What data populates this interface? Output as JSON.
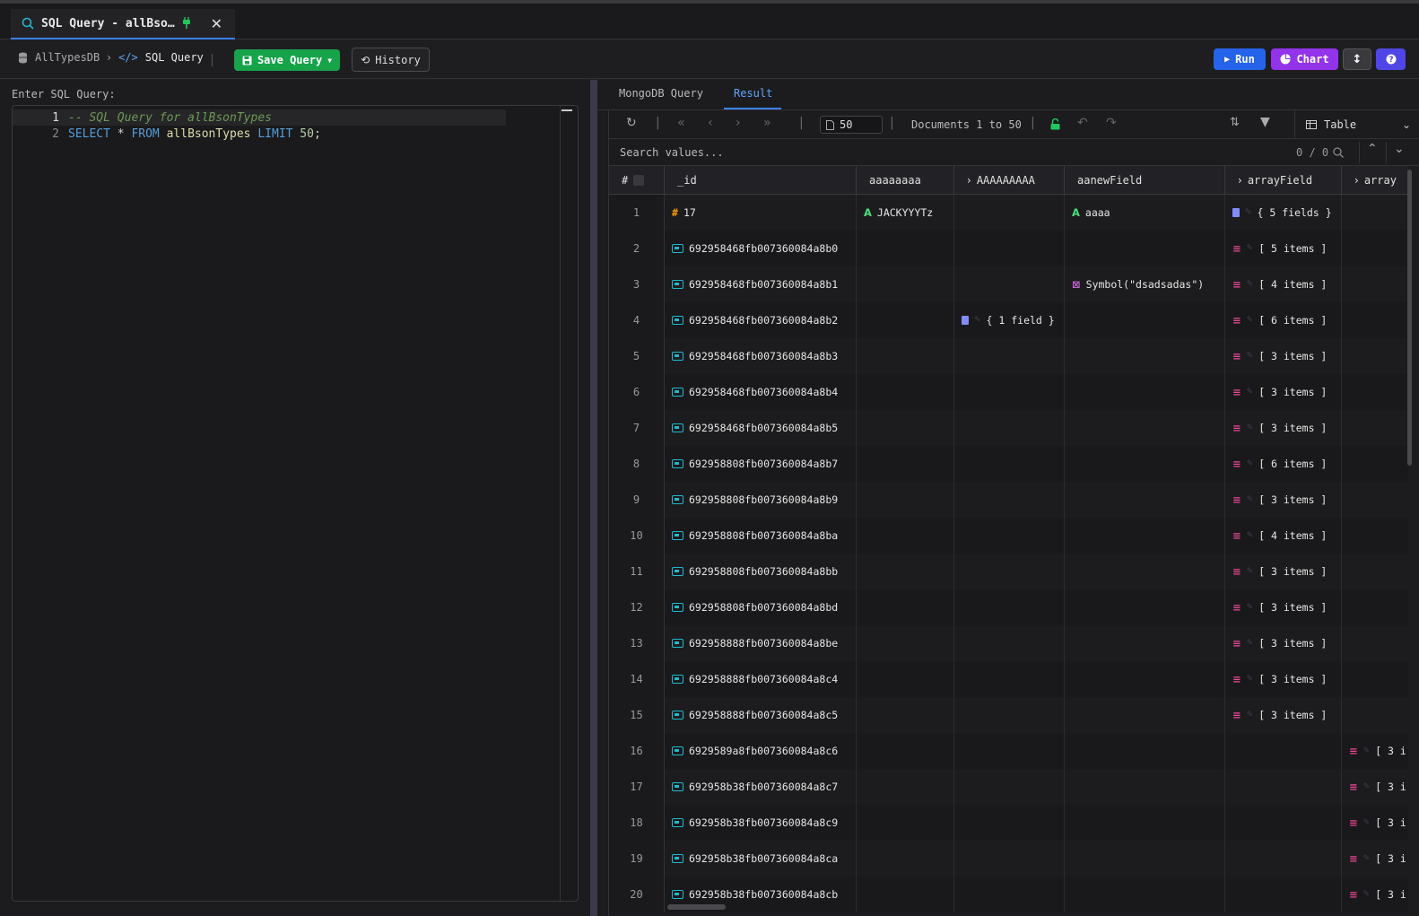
{
  "tab": {
    "title": "SQL Query - allBso…"
  },
  "breadcrumb": {
    "db": "AllTypesDB",
    "page": "SQL Query"
  },
  "toolbar": {
    "save_label": "Save Query",
    "history_label": "History",
    "run_label": "Run",
    "chart_label": "Chart"
  },
  "editor": {
    "label": "Enter SQL Query:",
    "lines": [
      {
        "num": "1",
        "comment": "-- SQL Query for allBsonTypes"
      },
      {
        "num": "2",
        "kw1": "SELECT",
        "star": " * ",
        "kw2": "FROM",
        "table": " allBsonTypes ",
        "kw3": "LIMIT",
        "limit": " 50",
        "semi": ";"
      }
    ]
  },
  "results": {
    "tabs": [
      "MongoDB Query",
      "Result"
    ],
    "active_tab": "Result",
    "limit": "50",
    "doc_info": "Documents 1 to 50",
    "view": "Table",
    "search_placeholder": "Search values...",
    "search_count": "0 / 0",
    "columns": [
      "#",
      "_id",
      "aaaaaaaa",
      "AAAAAAAAA",
      "aanewField",
      "arrayField",
      "array"
    ],
    "rows": [
      {
        "n": "1",
        "id": "17",
        "id_type": "number",
        "a8": "JACKYYYTz",
        "A9": "",
        "anew": "aaaa",
        "anew_type": "string",
        "arr": "{ 5 fields }",
        "arr_type": "object",
        "array": ""
      },
      {
        "n": "2",
        "id": "692958468fb007360084a8b0",
        "id_type": "oid",
        "a8": "",
        "A9": "",
        "anew": "",
        "arr": "[ 5 items ]",
        "arr_type": "array",
        "array": ""
      },
      {
        "n": "3",
        "id": "692958468fb007360084a8b1",
        "id_type": "oid",
        "a8": "",
        "A9": "",
        "anew": "Symbol(\"dsadsadas\")",
        "anew_type": "symbol",
        "arr": "[ 4 items ]",
        "arr_type": "array",
        "array": ""
      },
      {
        "n": "4",
        "id": "692958468fb007360084a8b2",
        "id_type": "oid",
        "a8": "",
        "A9": "{ 1 field }",
        "anew": "",
        "arr": "[ 6 items ]",
        "arr_type": "array",
        "array": ""
      },
      {
        "n": "5",
        "id": "692958468fb007360084a8b3",
        "id_type": "oid",
        "a8": "",
        "A9": "",
        "anew": "",
        "arr": "[ 3 items ]",
        "arr_type": "array",
        "array": ""
      },
      {
        "n": "6",
        "id": "692958468fb007360084a8b4",
        "id_type": "oid",
        "a8": "",
        "A9": "",
        "anew": "",
        "arr": "[ 3 items ]",
        "arr_type": "array",
        "array": ""
      },
      {
        "n": "7",
        "id": "692958468fb007360084a8b5",
        "id_type": "oid",
        "a8": "",
        "A9": "",
        "anew": "",
        "arr": "[ 3 items ]",
        "arr_type": "array",
        "array": ""
      },
      {
        "n": "8",
        "id": "692958808fb007360084a8b7",
        "id_type": "oid",
        "a8": "",
        "A9": "",
        "anew": "",
        "arr": "[ 6 items ]",
        "arr_type": "array",
        "array": ""
      },
      {
        "n": "9",
        "id": "692958808fb007360084a8b9",
        "id_type": "oid",
        "a8": "",
        "A9": "",
        "anew": "",
        "arr": "[ 3 items ]",
        "arr_type": "array",
        "array": ""
      },
      {
        "n": "10",
        "id": "692958808fb007360084a8ba",
        "id_type": "oid",
        "a8": "",
        "A9": "",
        "anew": "",
        "arr": "[ 4 items ]",
        "arr_type": "array",
        "array": ""
      },
      {
        "n": "11",
        "id": "692958808fb007360084a8bb",
        "id_type": "oid",
        "a8": "",
        "A9": "",
        "anew": "",
        "arr": "[ 3 items ]",
        "arr_type": "array",
        "array": ""
      },
      {
        "n": "12",
        "id": "692958808fb007360084a8bd",
        "id_type": "oid",
        "a8": "",
        "A9": "",
        "anew": "",
        "arr": "[ 3 items ]",
        "arr_type": "array",
        "array": ""
      },
      {
        "n": "13",
        "id": "692958888fb007360084a8be",
        "id_type": "oid",
        "a8": "",
        "A9": "",
        "anew": "",
        "arr": "[ 3 items ]",
        "arr_type": "array",
        "array": ""
      },
      {
        "n": "14",
        "id": "692958888fb007360084a8c4",
        "id_type": "oid",
        "a8": "",
        "A9": "",
        "anew": "",
        "arr": "[ 3 items ]",
        "arr_type": "array",
        "array": ""
      },
      {
        "n": "15",
        "id": "692958888fb007360084a8c5",
        "id_type": "oid",
        "a8": "",
        "A9": "",
        "anew": "",
        "arr": "[ 3 items ]",
        "arr_type": "array",
        "array": ""
      },
      {
        "n": "16",
        "id": "6929589a8fb007360084a8c6",
        "id_type": "oid",
        "a8": "",
        "A9": "",
        "anew": "",
        "arr": "",
        "array": "[ 3 i"
      },
      {
        "n": "17",
        "id": "692958b38fb007360084a8c7",
        "id_type": "oid",
        "a8": "",
        "A9": "",
        "anew": "",
        "arr": "",
        "array": "[ 3 i"
      },
      {
        "n": "18",
        "id": "692958b38fb007360084a8c9",
        "id_type": "oid",
        "a8": "",
        "A9": "",
        "anew": "",
        "arr": "",
        "array": "[ 3 i"
      },
      {
        "n": "19",
        "id": "692958b38fb007360084a8ca",
        "id_type": "oid",
        "a8": "",
        "A9": "",
        "anew": "",
        "arr": "",
        "array": "[ 3 i"
      },
      {
        "n": "20",
        "id": "692958b38fb007360084a8cb",
        "id_type": "oid",
        "a8": "",
        "A9": "",
        "anew": "",
        "arr": "",
        "array": "[ 3 i"
      }
    ]
  },
  "colors": {
    "accent": "#3b82f6",
    "save": "#16a34a",
    "run": "#2563eb",
    "chart": "#9333ea",
    "help": "#4f46e5"
  },
  "icons": [
    "search-icon",
    "plug-icon",
    "close-icon",
    "database-icon",
    "code-icon",
    "save-icon",
    "history-icon",
    "play-icon",
    "chart-pie-icon",
    "sort-icon",
    "help-icon",
    "refresh-icon",
    "first-page-icon",
    "prev-page-icon",
    "next-page-icon",
    "last-page-icon",
    "document-icon",
    "lock-icon",
    "undo-icon",
    "redo-icon",
    "filter-icon",
    "table-icon"
  ]
}
